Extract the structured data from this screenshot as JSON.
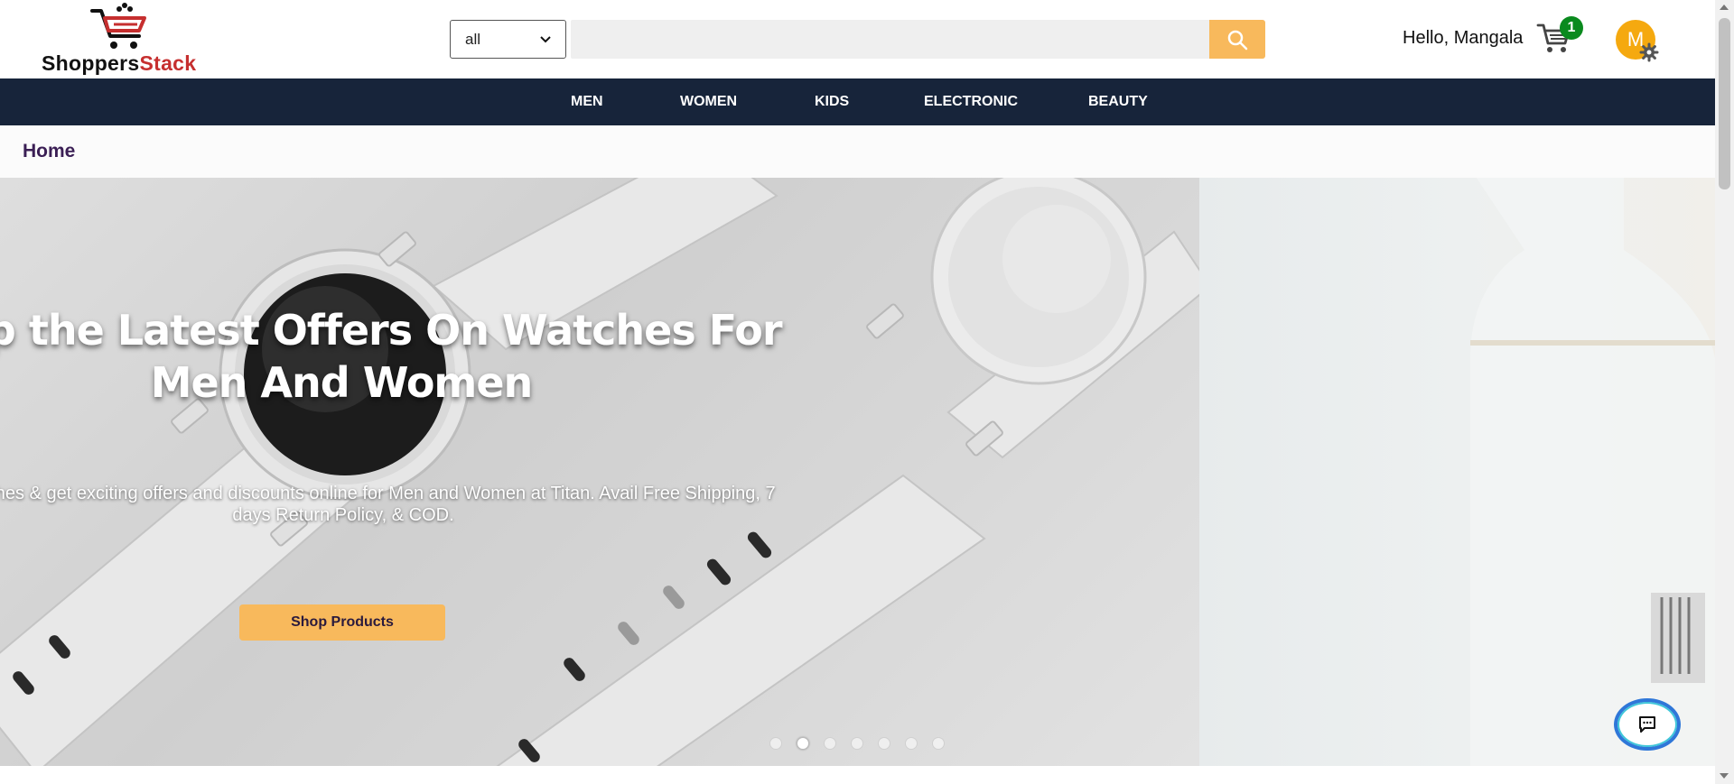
{
  "header": {
    "logo": {
      "text_primary": "Shoppers",
      "text_accent": "Stack",
      "icon": "shopping-cart-icon"
    },
    "search": {
      "category_selected": "all",
      "placeholder": "",
      "button_icon": "search-icon"
    },
    "greeting": "Hello, Mangala",
    "cart": {
      "icon": "cart-icon",
      "count": "1"
    },
    "account": {
      "avatar_letter": "M",
      "settings_icon": "gear-icon"
    }
  },
  "nav": {
    "items": [
      {
        "label": "MEN"
      },
      {
        "label": "WOMEN"
      },
      {
        "label": "KIDS"
      },
      {
        "label": "ELECTRONIC"
      },
      {
        "label": "BEAUTY"
      }
    ]
  },
  "breadcrumb": {
    "home": "Home"
  },
  "carousel": {
    "slide": {
      "title": "Shop the Latest Offers On Watches For Men And Women",
      "description": "Shop watches & get exciting offers and discounts online for Men and Women at Titan. Avail Free Shipping, 7 days Return Policy, & COD.",
      "button_label": "Shop Products"
    },
    "dots_count": 7,
    "active_dot_index": 1
  },
  "chat": {
    "icon": "chat-bubble-icon"
  },
  "colors": {
    "navbar": "#17243a",
    "accent": "#f8b95c",
    "badge": "#0a8a1e",
    "avatar": "#f5a90f",
    "brand_red": "#c62f2f"
  }
}
